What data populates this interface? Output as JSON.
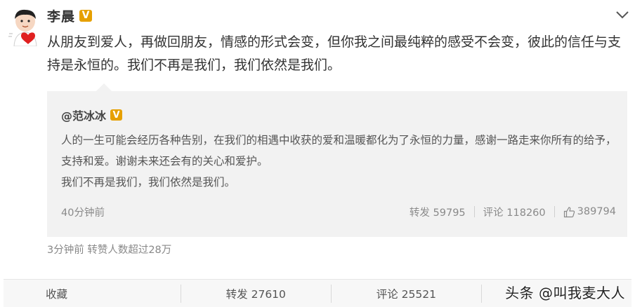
{
  "post": {
    "author": "李晨",
    "verified_badge": "V",
    "text": "从朋友到爱人，再做回朋友，情感的形式会变，但你我之间最纯粹的感受不会变，彼此的信任与支持是永恒的。我们不再是我们，我们依然是我们。",
    "meta": "3分钟前 转赞人数超过28万"
  },
  "quoted": {
    "author": "@范冰冰",
    "verified_badge": "V",
    "paragraph1": "人的一生可能会经历各种告别，在我们的相遇中收获的爱和温暖都化为了永恒的力量，感谢一路走来你所有的给予，支持和爱。谢谢未来还会有的关心和爱护。",
    "paragraph2": "我们不再是我们，我们依然是我们。",
    "time": "40分钟前",
    "repost": "转发 59795",
    "comment": "评论 118260",
    "like": "389794"
  },
  "footer": {
    "collect": "收藏",
    "repost": "转发 27610",
    "comment": "评论 25521"
  },
  "watermark": "头条 @叫我麦大人",
  "colors": {
    "badge": "#e6a000",
    "quote_bg": "#f2f2f2",
    "avatar_heart": "#e02020"
  },
  "icons": {
    "expand": "chevron-down-icon",
    "like": "thumbs-up-icon"
  }
}
